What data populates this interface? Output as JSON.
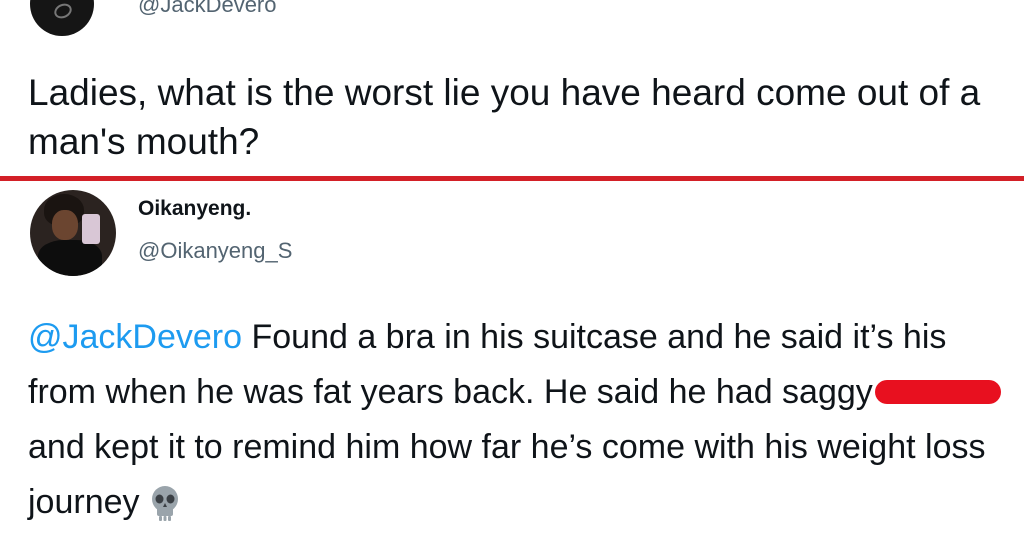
{
  "original_tweet": {
    "handle": "@JackDevero",
    "text": "Ladies, what is the worst lie you have heard come out of a man's mouth?"
  },
  "reply_tweet": {
    "display_name": "Oikanyeng.",
    "handle": "@Oikanyeng_S",
    "mention": "@JackDevero",
    "text_part1": " Found a bra in his suitcase and he said it’s his from when he was fat years back. He said he had saggy",
    "text_part2": "and kept it to remind him how far he’s come with his weight loss journey",
    "emoji_icon": "skull-icon"
  },
  "colors": {
    "divider": "#d32027",
    "mention": "#1d9bf0",
    "redaction": "#e8101f",
    "secondary_text": "#536471"
  }
}
